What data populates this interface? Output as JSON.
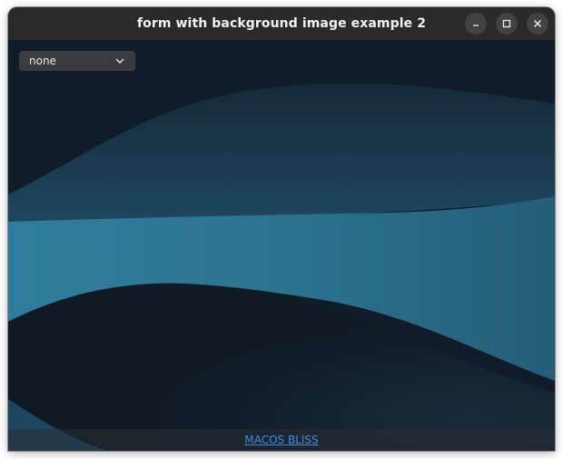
{
  "window": {
    "title": "form with background image example 2"
  },
  "titlebar_buttons": {
    "minimize_icon": "minimize-icon",
    "maximize_icon": "maximize-icon",
    "close_icon": "close-icon"
  },
  "combo": {
    "selected": "none",
    "arrow_icon": "chevron-down-icon"
  },
  "footer": {
    "link_label": "MACOS BLISS"
  },
  "colors": {
    "titlebar": "#2b2a2a",
    "background_dark": "#111d29",
    "wave_light": "#2e7a98",
    "link": "#3b8fd9"
  }
}
